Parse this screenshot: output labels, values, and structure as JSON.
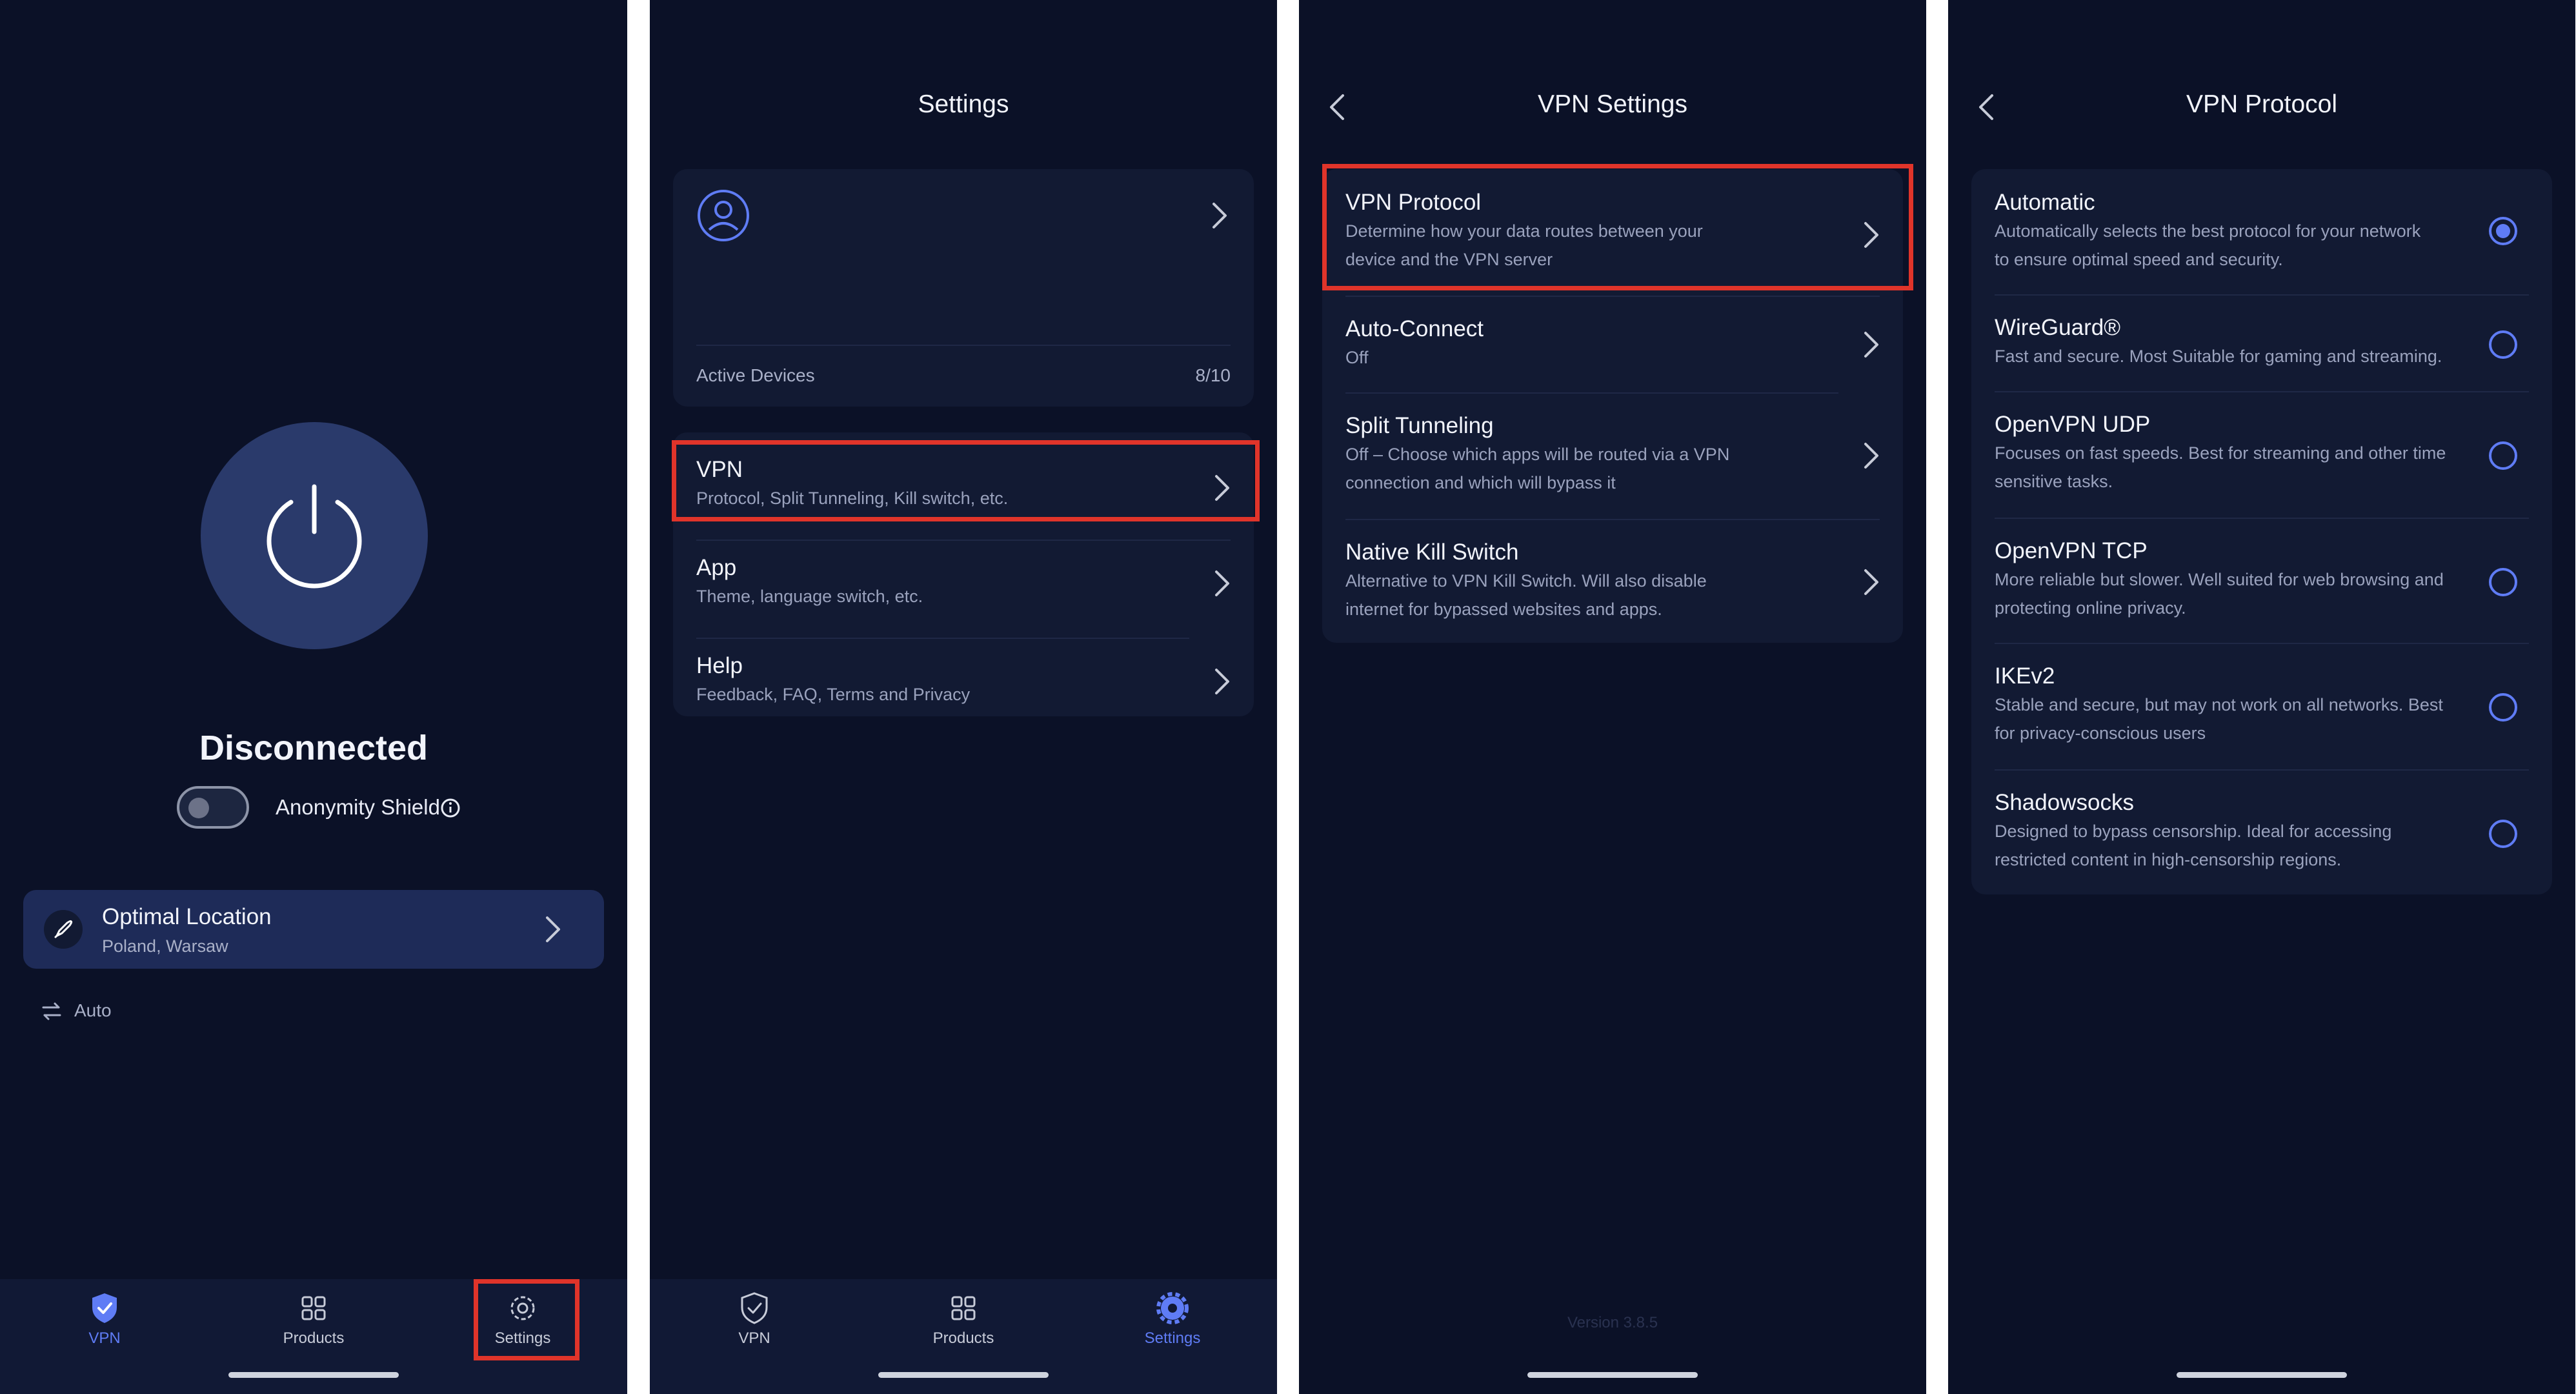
{
  "home": {
    "status": "Disconnected",
    "anonymity_label": "Anonymity Shield",
    "location_title": "Optimal Location",
    "location_sub": "Poland, Warsaw",
    "mode": "Auto"
  },
  "nav": {
    "vpn": "VPN",
    "products": "Products",
    "settings": "Settings"
  },
  "settings": {
    "title": "Settings",
    "active_devices_label": "Active Devices",
    "active_devices_value": "8/10",
    "items": [
      {
        "title": "VPN",
        "sub": "Protocol, Split Tunneling, Kill switch, etc."
      },
      {
        "title": "App",
        "sub": "Theme, language switch, etc."
      },
      {
        "title": "Help",
        "sub": "Feedback, FAQ, Terms and Privacy"
      }
    ]
  },
  "vpn_settings": {
    "title": "VPN Settings",
    "version": "Version 3.8.5",
    "items": [
      {
        "title": "VPN Protocol",
        "sub1": "Determine how your data routes between your",
        "sub2": "device and the VPN server"
      },
      {
        "title": "Auto-Connect",
        "sub1": "Off",
        "sub2": ""
      },
      {
        "title": "Split Tunneling",
        "sub1": "Off – Choose which apps will be routed via a VPN",
        "sub2": "connection and which will bypass it"
      },
      {
        "title": "Native Kill Switch",
        "sub1": "Alternative to VPN Kill Switch. Will also disable",
        "sub2": "internet for bypassed websites and apps."
      }
    ]
  },
  "vpn_protocol": {
    "title": "VPN Protocol",
    "selected": "Automatic",
    "items": [
      {
        "title": "Automatic",
        "sub1": "Automatically selects the best protocol for your network",
        "sub2": "to ensure optimal speed and security."
      },
      {
        "title": "WireGuard®",
        "sub1": "Fast and secure. Most Suitable for gaming and streaming.",
        "sub2": ""
      },
      {
        "title": "OpenVPN UDP",
        "sub1": "Focuses on fast speeds. Best for streaming and other time",
        "sub2": "sensitive tasks."
      },
      {
        "title": "OpenVPN TCP",
        "sub1": "More reliable but slower. Well suited for web browsing and",
        "sub2": "protecting online privacy."
      },
      {
        "title": "IKEv2",
        "sub1": "Stable and secure, but may not work on all networks. Best",
        "sub2": "for privacy-conscious users"
      },
      {
        "title": "Shadowsocks",
        "sub1": "Designed to bypass censorship. Ideal for accessing",
        "sub2": "restricted content in high-censorship regions."
      }
    ]
  },
  "colors": {
    "background": "#0b1127",
    "card": "#121a33",
    "accent": "#5f7cf5",
    "highlight_border": "#e0342a"
  }
}
